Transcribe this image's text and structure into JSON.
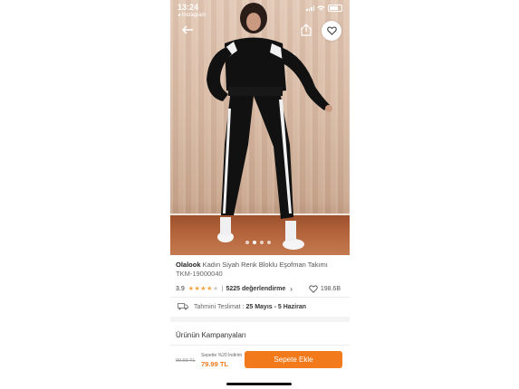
{
  "status_bar": {
    "time": "13:24",
    "back_app": "◂ Instagram"
  },
  "gallery": {
    "slide_count": 4,
    "active_slide_index": 1
  },
  "product": {
    "brand": "Olalook",
    "name": "Kadın Siyah Renk Bloklu Eşofman Takımı",
    "sku": "TKM-19000040",
    "rating_value": "3.9",
    "rating": 3.9,
    "rating_max": 5,
    "review_count": "5225 değerlendirme",
    "likes": "198.6B"
  },
  "delivery": {
    "label": "Tahmini Teslimat :",
    "range": "25 Mayıs - 5 Haziran"
  },
  "campaigns": {
    "title": "Ürünün Kampanyaları"
  },
  "purchase": {
    "old_price": "99.99 TL",
    "promo_text": "Sepette %20 İndirim",
    "new_price": "79.99 TL",
    "add_to_cart": "Sepete Ekle"
  },
  "colors": {
    "accent": "#f27a1a",
    "star": "#f2a33a"
  },
  "icons": [
    "back-arrow-icon",
    "share-icon",
    "heart-icon",
    "star-icon",
    "chevron-right-icon",
    "truck-icon",
    "signal-icon",
    "wifi-icon",
    "battery-icon"
  ]
}
